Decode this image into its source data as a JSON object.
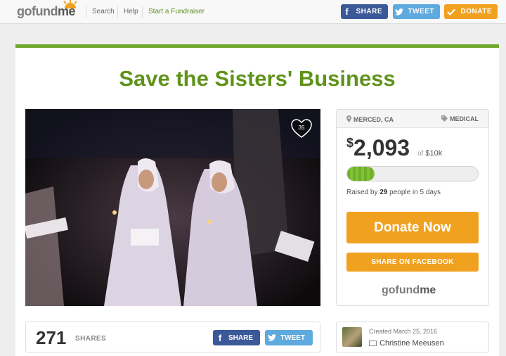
{
  "nav": {
    "logo": {
      "part1": "gofund",
      "part2": "me"
    },
    "links": [
      "Search",
      "Help",
      "Start a Fundraiser"
    ],
    "buttons": {
      "share": "SHARE",
      "tweet": "TWEET",
      "donate": "DONATE"
    }
  },
  "campaign": {
    "title": "Save the Sisters' Business",
    "photo_likes": "35",
    "location": "MERCED, CA",
    "category": "MEDICAL",
    "currency": "$",
    "raised": "2,093",
    "goal_prefix": "of",
    "goal": "$10k",
    "progress_fraction": 0.21,
    "raised_by_prefix": "Raised by",
    "people": "29",
    "raised_by_suffix": "people in 5 days",
    "donate_button": "Donate Now",
    "share_facebook_button": "SHARE ON FACEBOOK",
    "side_logo": {
      "part1": "gofund",
      "part2": "me"
    }
  },
  "shares": {
    "count": "271",
    "label": "SHARES",
    "share_button": "SHARE",
    "tweet_button": "TWEET"
  },
  "creator": {
    "created": "Created March 25, 2016",
    "name": "Christine Meeusen"
  },
  "colors": {
    "green": "#5f931a",
    "orange": "#f0a11f",
    "facebook": "#3b5998",
    "twitter": "#5ea9dd"
  }
}
